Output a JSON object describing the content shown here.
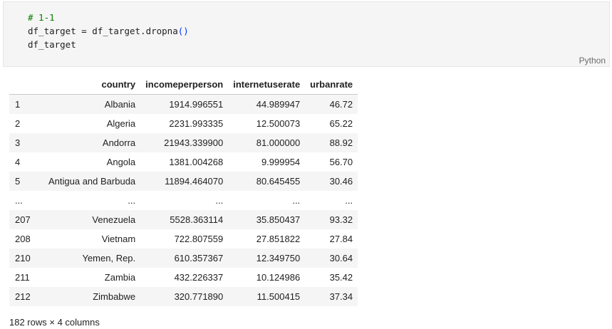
{
  "code_cell": {
    "line1": "# 1-1",
    "line2_a": "df_target = df_target.dropna",
    "line2_b": "()",
    "line3": "df_target",
    "language": "Python"
  },
  "table": {
    "columns": [
      "",
      "country",
      "incomeperperson",
      "internetuserate",
      "urbanrate"
    ],
    "rows": [
      [
        "1",
        "Albania",
        "1914.996551",
        "44.989947",
        "46.72"
      ],
      [
        "2",
        "Algeria",
        "2231.993335",
        "12.500073",
        "65.22"
      ],
      [
        "3",
        "Andorra",
        "21943.339900",
        "81.000000",
        "88.92"
      ],
      [
        "4",
        "Angola",
        "1381.004268",
        "9.999954",
        "56.70"
      ],
      [
        "5",
        "Antigua and Barbuda",
        "11894.464070",
        "80.645455",
        "30.46"
      ],
      [
        "...",
        "...",
        "...",
        "...",
        "..."
      ],
      [
        "207",
        "Venezuela",
        "5528.363114",
        "35.850437",
        "93.32"
      ],
      [
        "208",
        "Vietnam",
        "722.807559",
        "27.851822",
        "27.84"
      ],
      [
        "210",
        "Yemen, Rep.",
        "610.357367",
        "12.349750",
        "30.64"
      ],
      [
        "211",
        "Zambia",
        "432.226337",
        "10.124986",
        "35.42"
      ],
      [
        "212",
        "Zimbabwe",
        "320.771890",
        "11.500415",
        "37.34"
      ]
    ]
  },
  "shape_note": "182 rows × 4 columns"
}
